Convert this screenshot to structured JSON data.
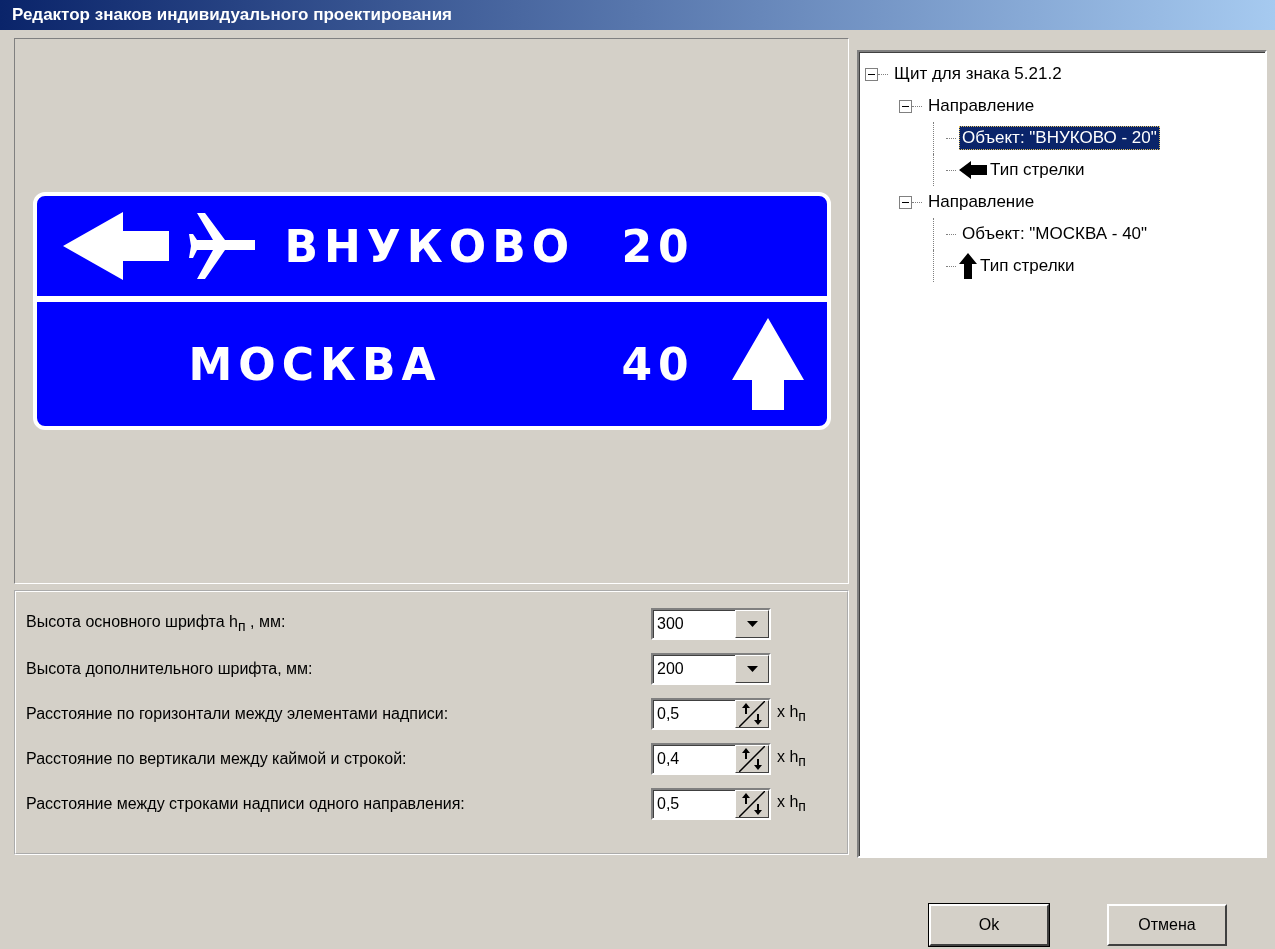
{
  "window": {
    "title": "Редактор знаков индивидуального проектирования"
  },
  "sign": {
    "rows": [
      {
        "kind": "leftarrow",
        "name": "ВНУКОВО",
        "distance": "20",
        "airport": true
      },
      {
        "kind": "uparrow",
        "name": "МОСКВА",
        "distance": "40",
        "airport": false
      }
    ]
  },
  "settings": [
    {
      "kind": "dropdown",
      "label": "Высота основного шрифта h$_{п}$ , мм:",
      "value": "300"
    },
    {
      "kind": "dropdown",
      "label": "Высота дополнительного шрифта, мм:",
      "value": "200"
    },
    {
      "kind": "spinner",
      "label": "Расстояние по горизонтали между элементами надписи:",
      "value": "0,5",
      "unit": "x h$_{п}$"
    },
    {
      "kind": "spinner",
      "label": "Расстояние по вертикали между каймой и строкой:",
      "value": "0,4",
      "unit": "x h$_{п}$"
    },
    {
      "kind": "spinner",
      "label": "Расстояние между строками надписи одного направления:",
      "value": "0,5",
      "unit": "x h$_{п}$"
    }
  ],
  "tree": [
    {
      "label": "Щит для знака 5.21.2",
      "expanded": true,
      "selected": false,
      "children": [
        {
          "label": "Направление",
          "expanded": true,
          "selected": false,
          "children": [
            {
              "kind": "object",
              "label": "Объект: \"ВНУКОВО - 20\"",
              "selected": true
            },
            {
              "kind": "leftarrow",
              "label": "Тип стрелки",
              "selected": false
            }
          ]
        },
        {
          "label": "Направление",
          "expanded": true,
          "selected": false,
          "children": [
            {
              "kind": "object",
              "label": "Объект: \"МОСКВА - 40\"",
              "selected": false
            },
            {
              "kind": "uparrow",
              "label": "Тип стрелки",
              "selected": false
            }
          ]
        }
      ]
    }
  ],
  "buttons": [
    "Ok",
    "Отмена"
  ]
}
